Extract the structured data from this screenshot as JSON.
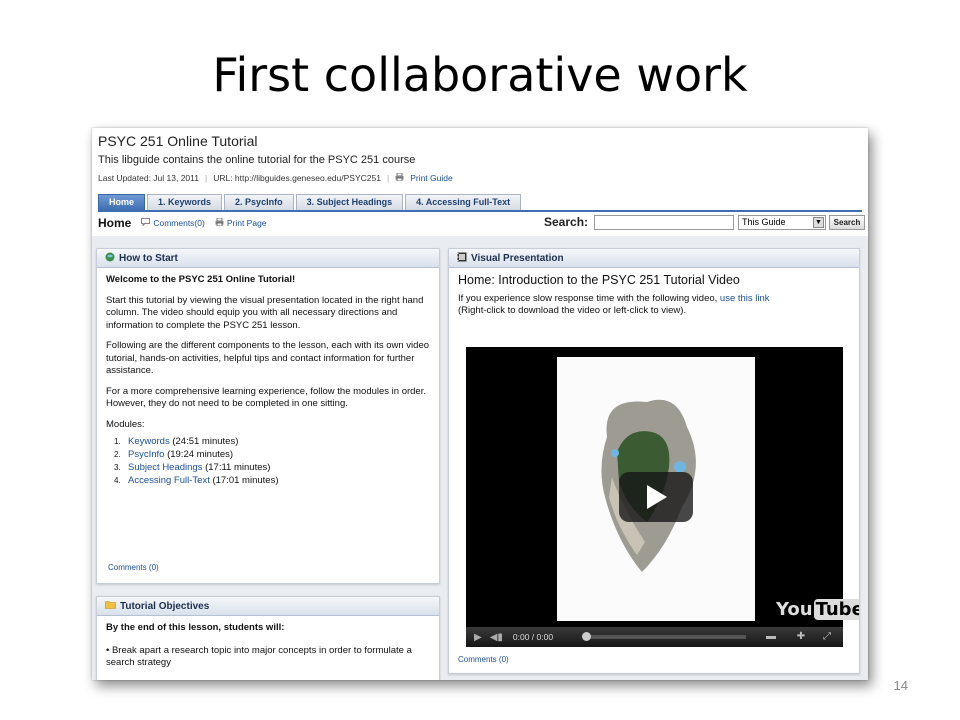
{
  "slide": {
    "title": "First collaborative work",
    "page_number": "14"
  },
  "guide": {
    "title": "PSYC 251 Online Tutorial",
    "description": "This libguide contains the online tutorial for the PSYC 251 course",
    "last_updated": "Last Updated: Jul 13, 2011",
    "url": "URL: http://libguides.geneseo.edu/PSYC251",
    "print_guide": "Print Guide"
  },
  "tabs": [
    {
      "label": "Home",
      "active": true
    },
    {
      "label": "1. Keywords",
      "active": false
    },
    {
      "label": "2. PsycInfo",
      "active": false
    },
    {
      "label": "3. Subject Headings",
      "active": false
    },
    {
      "label": "4. Accessing Full-Text",
      "active": false
    }
  ],
  "subbar": {
    "page": "Home",
    "comments": "Comments(0)",
    "print_page": "Print Page",
    "search_label": "Search:",
    "search_value": "",
    "scope_value": "This Guide",
    "search_button": "Search"
  },
  "how_to_start": {
    "header": "How to Start",
    "welcome": "Welcome to the PSYC 251 Online Tutorial!",
    "p1": "Start this tutorial by viewing the visual presentation located in the right hand column. The video should equip you with all necessary directions and information to complete the PSYC 251 lesson.",
    "p2": "Following are the different components to the lesson, each with its own video tutorial, hands-on activities, helpful tips and contact information for further assistance.",
    "p3": "For a more comprehensive learning experience, follow the modules in order. However, they do not need to be completed in one sitting.",
    "modules_label": "Modules:",
    "modules": [
      {
        "num": "1.",
        "name": "Keywords",
        "time": "(24:51 minutes)"
      },
      {
        "num": "2.",
        "name": "PsycInfo",
        "time": "(19:24 minutes)"
      },
      {
        "num": "3.",
        "name": "Subject Headings",
        "time": "(17:11 minutes)"
      },
      {
        "num": "4.",
        "name": "Accessing Full-Text",
        "time": "(17:01 minutes)"
      }
    ],
    "comments": "Comments (0)"
  },
  "objectives": {
    "header": "Tutorial Objectives",
    "intro": "By the end of this lesson, students will:",
    "bullet1": "• Break apart a research topic into major concepts in order to formulate a search strategy"
  },
  "visual": {
    "header": "Visual Presentation",
    "title": "Home: Introduction to the PSYC 251 Tutorial Video",
    "text_before": "If you experience slow response time with the following video,",
    "link_text": "use this link",
    "text_after": "(Right-click to download the video or left-click to view).",
    "time_display": "0:00 / 0:00",
    "logo_you": "You",
    "logo_tube": "Tube",
    "comments": "Comments (0)"
  },
  "colors": {
    "tab_active": "#3f6fb3",
    "link": "#1a4f9c",
    "panel_bg": "#e9ecf0"
  }
}
